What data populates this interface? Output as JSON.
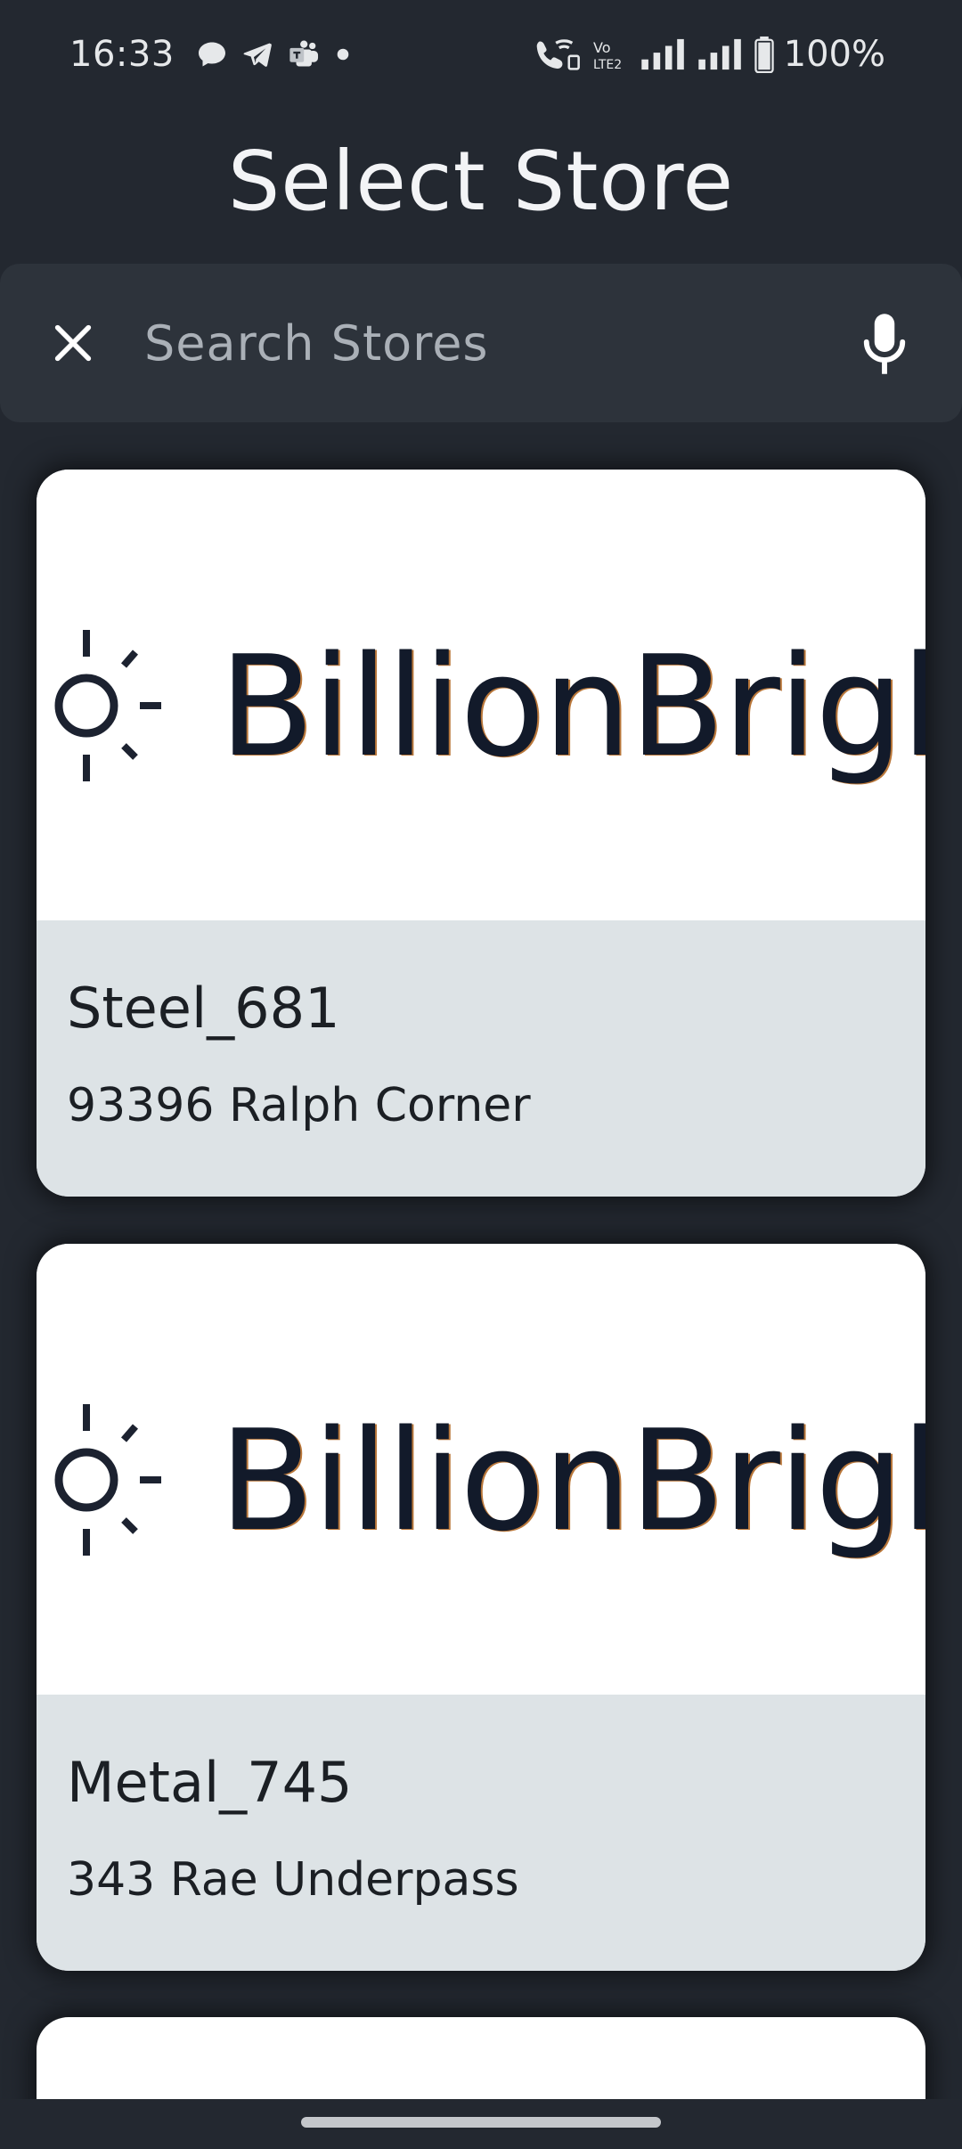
{
  "status_bar": {
    "time": "16:33",
    "battery": "100%",
    "left_icons": [
      "chat-bubble-icon",
      "telegram-icon",
      "teams-icon",
      "dot-icon"
    ],
    "right_icons": [
      "wifi-call-icon",
      "volte-icon",
      "signal-icon",
      "signal-icon",
      "battery-icon"
    ]
  },
  "header": {
    "title": "Select Store"
  },
  "search": {
    "placeholder": "Search Stores",
    "value": ""
  },
  "stores": [
    {
      "logo_text": "BillionBright",
      "name": "Steel_681",
      "address": "93396 Ralph Corner"
    },
    {
      "logo_text": "BillionBright",
      "name": "Metal_745",
      "address": "343 Rae Underpass"
    }
  ],
  "colors": {
    "background": "#232830",
    "search_bg": "#2d333b",
    "card_info_bg": "#dde3e6",
    "logo_text": "#121a2a"
  }
}
